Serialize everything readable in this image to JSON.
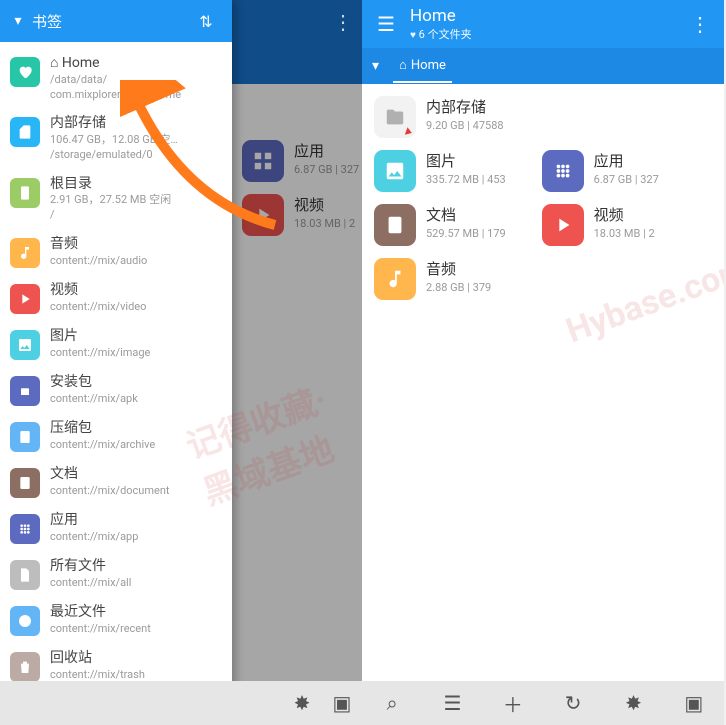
{
  "left": {
    "drawer_title": "书签",
    "bookmarks": [
      {
        "name": "⌂ Home",
        "meta1": "/data/data/",
        "meta2": "com.mixplorer.silver/home",
        "color": "c-teal",
        "icon": "heart"
      },
      {
        "name": "内部存储",
        "meta1": "106.47 GB，12.08 GB 空…",
        "meta2": "/storage/emulated/0",
        "color": "c-blue",
        "icon": "sd"
      },
      {
        "name": "根目录",
        "meta1": "2.91 GB，27.52 MB 空闲",
        "meta2": "/",
        "color": "c-green",
        "icon": "phone"
      },
      {
        "name": "音频",
        "meta1": "content://mix/audio",
        "color": "c-orange",
        "icon": "music"
      },
      {
        "name": "视频",
        "meta1": "content://mix/video",
        "color": "c-red",
        "icon": "play"
      },
      {
        "name": "图片",
        "meta1": "content://mix/image",
        "color": "c-cyan",
        "icon": "image"
      },
      {
        "name": "安装包",
        "meta1": "content://mix/apk",
        "color": "c-purple",
        "icon": "android"
      },
      {
        "name": "压缩包",
        "meta1": "content://mix/archive",
        "color": "c-lblue",
        "icon": "zip"
      },
      {
        "name": "文档",
        "meta1": "content://mix/document",
        "color": "c-brown",
        "icon": "doc"
      },
      {
        "name": "应用",
        "meta1": "content://mix/app",
        "color": "c-purple",
        "icon": "apps"
      },
      {
        "name": "所有文件",
        "meta1": "content://mix/all",
        "color": "c-grey",
        "icon": "file"
      },
      {
        "name": "最近文件",
        "meta1": "content://mix/recent",
        "color": "c-lblue",
        "icon": "clock"
      },
      {
        "name": "回收站",
        "meta1": "content://mix/trash",
        "color": "c-tan",
        "icon": "trash"
      }
    ],
    "bg_items": [
      {
        "name": "应用",
        "meta": "6.87 GB | 327"
      },
      {
        "name": "视频",
        "meta": "18.03 MB | 2"
      }
    ]
  },
  "right": {
    "header_title": "Home",
    "header_sub": "6 个文件夹",
    "tab_label": "Home",
    "items": [
      {
        "name": "内部存储",
        "meta": "9.20 GB | 47588",
        "color": "folder",
        "icon": "folder",
        "full": true
      },
      {
        "name": "图片",
        "meta": "335.72 MB | 453",
        "color": "c-cyan",
        "icon": "image"
      },
      {
        "name": "应用",
        "meta": "6.87 GB | 327",
        "color": "c-purple",
        "icon": "apps"
      },
      {
        "name": "文档",
        "meta": "529.57 MB | 179",
        "color": "c-brown",
        "icon": "doc"
      },
      {
        "name": "视频",
        "meta": "18.03 MB | 2",
        "color": "c-red",
        "icon": "play"
      },
      {
        "name": "音频",
        "meta": "2.88 GB | 379",
        "color": "c-orange",
        "icon": "music"
      }
    ]
  },
  "watermark1": "记得收藏·黑域基地",
  "watermark2": "Hybase.com",
  "icons": {
    "heart": "♥",
    "sd": "▤",
    "phone": "▭",
    "music": "♪",
    "play": "▶",
    "image": "▣",
    "android": "◉",
    "zip": "▥",
    "doc": "☰",
    "apps": "▦",
    "file": "□",
    "clock": "◷",
    "trash": "🗑",
    "folder": "📁"
  }
}
